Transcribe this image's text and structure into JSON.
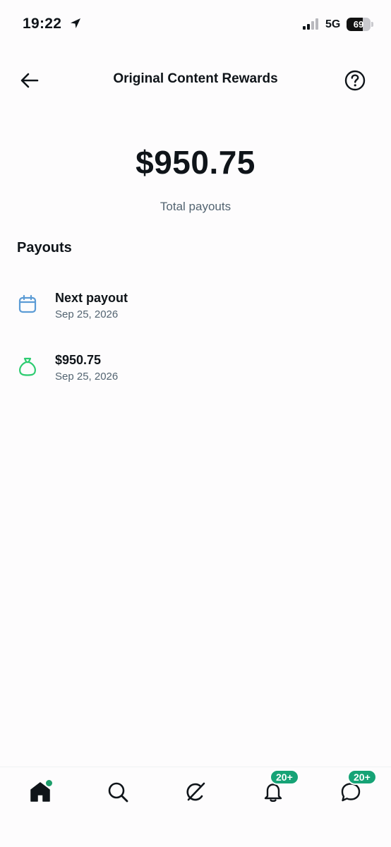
{
  "status_bar": {
    "time": "19:22",
    "network": "5G",
    "battery_level": "69",
    "battery_fraction": 0.69
  },
  "header": {
    "title": "Original Content Rewards",
    "back_icon": "arrow-left-icon",
    "help_icon": "question-circle-icon"
  },
  "summary": {
    "total_amount": "$950.75",
    "total_label": "Total payouts"
  },
  "payouts": {
    "section_title": "Payouts",
    "items": [
      {
        "icon": "calendar-icon",
        "icon_color": "#5b9bd5",
        "title": "Next payout",
        "date": "Sep 25, 2026"
      },
      {
        "icon": "money-bag-icon",
        "icon_color": "#2ecc71",
        "title": "$950.75",
        "date": "Sep 25, 2026"
      }
    ]
  },
  "bottom_nav": {
    "items": [
      {
        "name": "home",
        "icon": "home-icon",
        "active": true
      },
      {
        "name": "search",
        "icon": "search-icon"
      },
      {
        "name": "grok",
        "icon": "grok-icon"
      },
      {
        "name": "notifications",
        "icon": "bell-icon",
        "badge": "20+"
      },
      {
        "name": "messages",
        "icon": "message-icon",
        "badge": "20+"
      }
    ],
    "accent_color": "#16a376"
  }
}
